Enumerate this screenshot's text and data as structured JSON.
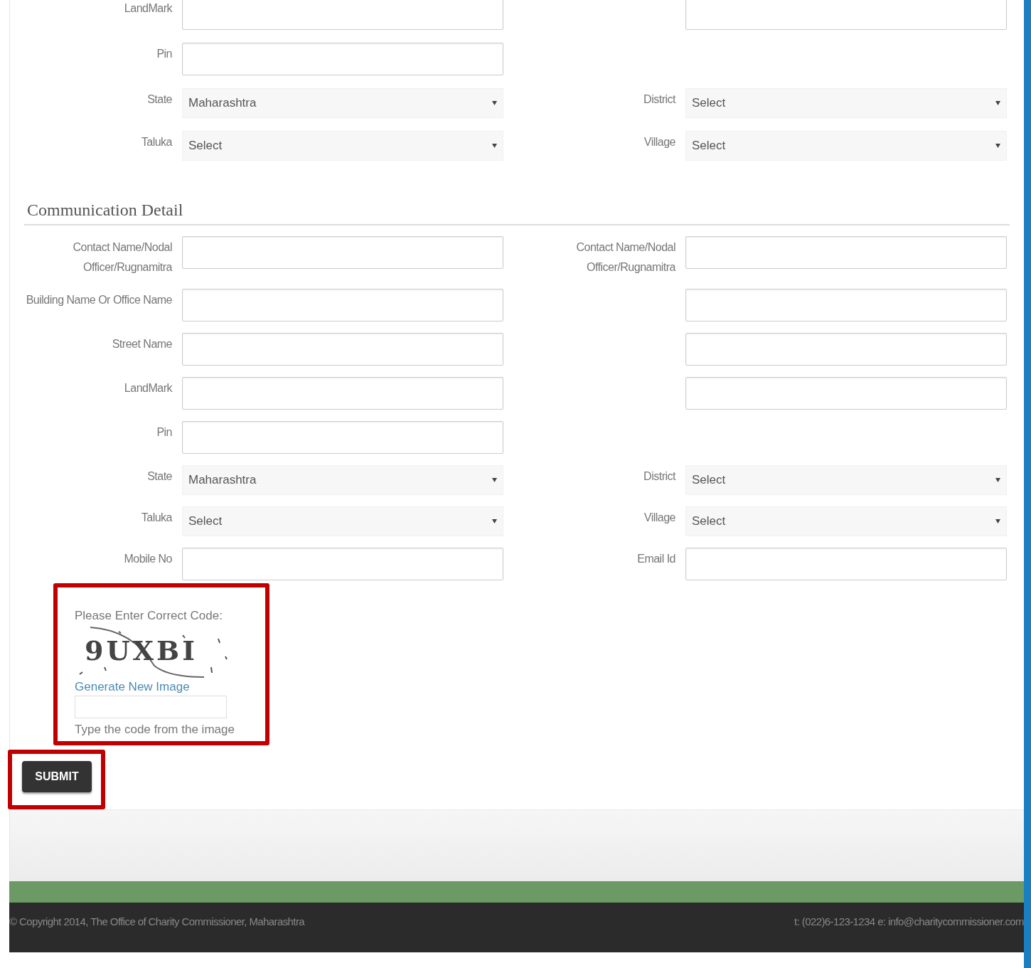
{
  "address_rows": [
    {
      "left": {
        "label": "LandMark",
        "kind": "text"
      },
      "right": {
        "kind": "text"
      }
    },
    {
      "left": {
        "label": "Pin",
        "kind": "text"
      }
    },
    {
      "left": {
        "label": "State",
        "kind": "select",
        "value": "Maharashtra"
      },
      "right": {
        "label": "District",
        "kind": "select",
        "value": "Select"
      }
    },
    {
      "left": {
        "label": "Taluka",
        "kind": "select",
        "value": "Select"
      },
      "right": {
        "label": "Village",
        "kind": "select",
        "value": "Select"
      }
    }
  ],
  "communication_detail": {
    "title": "Communication Detail",
    "rows": [
      {
        "left": {
          "label": "Contact Name/Nodal Officer/Rugnamitra",
          "kind": "text"
        },
        "right": {
          "label": "Contact Name/Nodal Officer/Rugnamitra",
          "kind": "text"
        }
      },
      {
        "left": {
          "label": "Building Name Or Office Name",
          "kind": "text"
        },
        "right": {
          "kind": "text"
        }
      },
      {
        "left": {
          "label": "Street Name",
          "kind": "text"
        },
        "right": {
          "kind": "text"
        }
      },
      {
        "left": {
          "label": "LandMark",
          "kind": "text"
        },
        "right": {
          "kind": "text"
        }
      },
      {
        "left": {
          "label": "Pin",
          "kind": "text"
        }
      },
      {
        "left": {
          "label": "State",
          "kind": "select",
          "value": "Maharashtra"
        },
        "right": {
          "label": "District",
          "kind": "select",
          "value": "Select"
        }
      },
      {
        "left": {
          "label": "Taluka",
          "kind": "select",
          "value": "Select"
        },
        "right": {
          "label": "Village",
          "kind": "select",
          "value": "Select"
        }
      },
      {
        "left": {
          "label": "Mobile No",
          "kind": "text"
        },
        "right": {
          "label": "Email Id",
          "kind": "text"
        }
      }
    ]
  },
  "captcha": {
    "highlighted": true,
    "prompt": "Please Enter Correct Code:",
    "code": "9UXBI",
    "link": "Generate New Image",
    "hint": "Type the code from the image"
  },
  "submit_button": {
    "label": "SUBMIT",
    "highlighted": true
  },
  "footer": {
    "copyright": "© Copyright 2014, The Office of Charity Commissioner, Maharashtra",
    "contact": "t: (022)6-123-1234 e: info@charitycommissioner.com"
  }
}
